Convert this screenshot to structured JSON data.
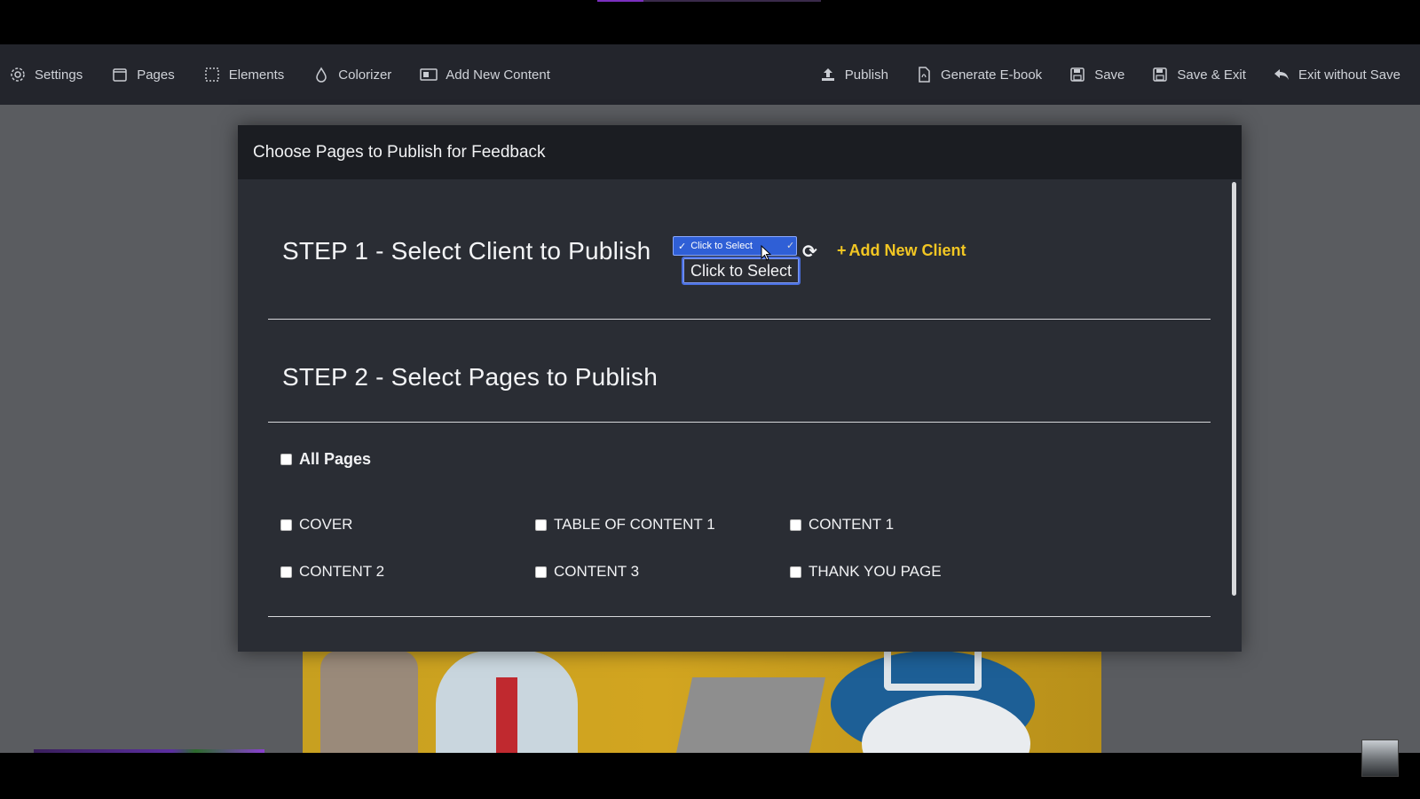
{
  "toolbar": {
    "left": [
      {
        "label": "Settings",
        "icon": "gear-icon"
      },
      {
        "label": "Pages",
        "icon": "page-icon"
      },
      {
        "label": "Elements",
        "icon": "elements-icon"
      },
      {
        "label": "Colorizer",
        "icon": "drop-icon"
      },
      {
        "label": "Add New Content",
        "icon": "add-content-icon"
      }
    ],
    "right": [
      {
        "label": "Publish",
        "icon": "upload-icon"
      },
      {
        "label": "Generate E-book",
        "icon": "pdf-icon"
      },
      {
        "label": "Save",
        "icon": "save-icon"
      },
      {
        "label": "Save & Exit",
        "icon": "save-exit-icon"
      },
      {
        "label": "Exit without Save",
        "icon": "undo-icon"
      }
    ]
  },
  "modal": {
    "title": "Choose Pages to Publish for Feedback",
    "step1": {
      "title": "STEP 1 - Select Client to Publish",
      "select_value": "Click to Select",
      "select_tooltip": "Click to Select",
      "add_client_label": "Add New Client"
    },
    "step2": {
      "title": "STEP 2 - Select Pages to Publish",
      "all_pages_label": "All Pages",
      "pages": [
        {
          "label": "COVER",
          "checked": false
        },
        {
          "label": "TABLE OF CONTENT 1",
          "checked": false
        },
        {
          "label": "CONTENT 1",
          "checked": false
        },
        {
          "label": "CONTENT 2",
          "checked": false
        },
        {
          "label": "CONTENT 3",
          "checked": false
        },
        {
          "label": "THANK YOU PAGE",
          "checked": false
        }
      ]
    }
  },
  "colors": {
    "accent_yellow": "#f2c623",
    "select_blue": "#2f5fd6",
    "modal_bg": "#2a2d34",
    "header_bg": "#1b1d22"
  }
}
